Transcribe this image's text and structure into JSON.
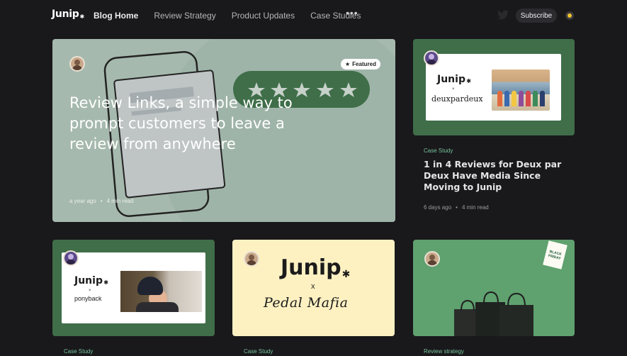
{
  "header": {
    "logo": "Junip",
    "nav": [
      "Blog Home",
      "Review Strategy",
      "Product Updates",
      "Case Studies"
    ],
    "more": "•••",
    "subscribe": "Subscribe"
  },
  "hero": {
    "badge": "Featured",
    "title": "Review Links, a simple way to prompt customers to leave a review from anywhere",
    "date": "a year ago",
    "read": "4 min read",
    "stars": 5
  },
  "card2": {
    "brand": "Junip",
    "x": "×",
    "partner": "deuxpardeux",
    "tag": "Case Study",
    "title": "1 in 4 Reviews for Deux par Deux Have Media Since Moving to Junip",
    "date": "6 days ago",
    "read": "4 min read"
  },
  "card3": {
    "brand": "Junip",
    "x": "×",
    "partner": "ponyback",
    "tag": "Case Study"
  },
  "card4": {
    "brand": "Junip",
    "x": "x",
    "partner": "Pedal Mafia",
    "tag": "Case Study"
  },
  "card5": {
    "sticker": "BLACK FRIDAY",
    "tag": "Review strategy"
  },
  "colors": {
    "background": "#19181b",
    "green": "#3f6e49",
    "accent": "#77c59b",
    "hero": "#a6b9ae"
  }
}
